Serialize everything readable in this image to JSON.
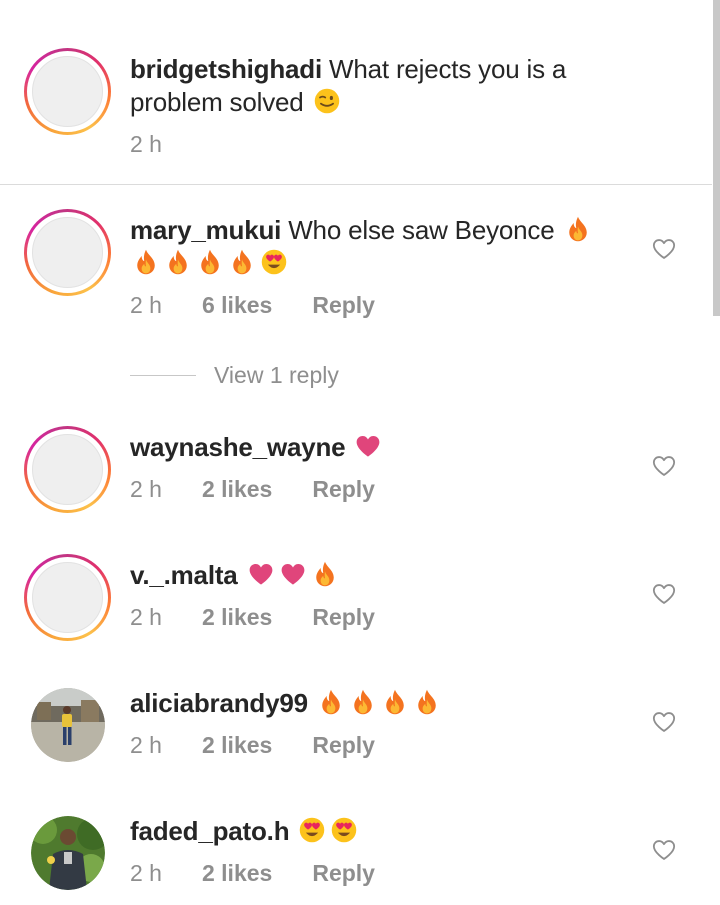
{
  "caption": {
    "username": "bridgetshighadi",
    "text": "What rejects you is a problem solved",
    "emoji": "wink-emoji",
    "time": "2 h"
  },
  "comments": [
    {
      "username": "mary_mukui",
      "text": "Who else saw Beyonce",
      "emojis": [
        "fire",
        "fire",
        "fire",
        "fire",
        "fire",
        "heart-eyes"
      ],
      "time": "2 h",
      "likes": "6 likes",
      "reply": "Reply",
      "view_replies": "View 1 reply"
    },
    {
      "username": "waynashe_wayne",
      "text": "",
      "emojis": [
        "pink-heart"
      ],
      "time": "2 h",
      "likes": "2 likes",
      "reply": "Reply"
    },
    {
      "username": "v._.malta",
      "text": "",
      "emojis": [
        "pink-heart",
        "pink-heart",
        "fire"
      ],
      "time": "2 h",
      "likes": "2 likes",
      "reply": "Reply"
    },
    {
      "username": "aliciabrandy99",
      "text": "",
      "emojis": [
        "fire",
        "fire",
        "fire",
        "fire"
      ],
      "time": "2 h",
      "likes": "2 likes",
      "reply": "Reply"
    },
    {
      "username": "faded_pato.h",
      "text": "",
      "emojis": [
        "heart-eyes",
        "heart-eyes"
      ],
      "time": "2 h",
      "likes": "2 likes",
      "reply": "Reply"
    }
  ],
  "colors": {
    "text": "#262626",
    "meta": "#8e8e8e",
    "heart_emoji": "#e0457b",
    "divider": "#dbdbdb"
  }
}
